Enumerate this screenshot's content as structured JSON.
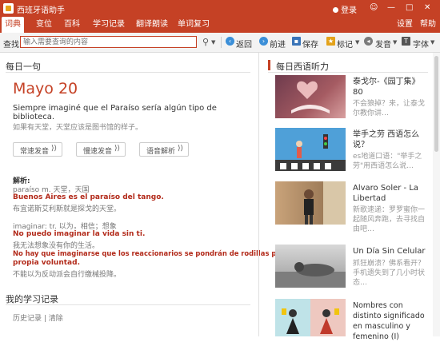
{
  "app": {
    "title": "西班牙语助手",
    "login_label": "登录",
    "window_controls": [
      "☺",
      "—",
      "□",
      "✕"
    ]
  },
  "menu": {
    "tabs": [
      "词典",
      "变位",
      "百科",
      "学习记录",
      "翻译朗读",
      "单词复习"
    ],
    "active_tab": "词典",
    "right_links": [
      "设置",
      "帮助"
    ]
  },
  "toolbar": {
    "search_label": "查找",
    "search_placeholder": "输入需要查询的内容",
    "buttons": [
      "返回",
      "前进",
      "保存",
      "标记",
      "发音",
      "字体"
    ]
  },
  "daily": {
    "section_title": "每日一句",
    "date": "Mayo 20",
    "sentence_es": "Siempre imaginé que el Paraíso sería algún tipo de biblioteca.",
    "sentence_zh": "如果有天堂，天堂应该是图书馆的样子。",
    "play_buttons": [
      "常速发音",
      "慢速发音",
      "语音解析"
    ],
    "analysis_title": "解析:",
    "analysis_lines": [
      {
        "text": "paraíso m. 天堂，天国",
        "style": "gray"
      },
      {
        "text": "Buenos Aires es el paraíso del tango.",
        "style": "red"
      },
      {
        "text": "布宜诺斯艾利斯就是探戈的天堂。",
        "style": "gray"
      },
      {
        "text": "imaginar: tr. 以为，相信；想象",
        "style": "gray"
      },
      {
        "text": "No puedo imaginar la vida sin ti.",
        "style": "red"
      },
      {
        "text": "我无法想象没有你的生活。",
        "style": "gray"
      },
      {
        "text": "No hay que imaginarse que los reaccionarios se pondrán de rodillas por",
        "style": "red"
      },
      {
        "text": "propia voluntad.",
        "style": "red"
      },
      {
        "text": "不能以为反动派会自行缴械投降。",
        "style": "gray"
      }
    ]
  },
  "history": {
    "section_title": "我的学习记录",
    "links": "历史记录 | 清除"
  },
  "listening": {
    "section_title": "每日西语听力",
    "items": [
      {
        "title": "泰戈尔-《园丁集》80",
        "subtitle": "不会狼掉？来，让泰戈尔教你讲…"
      },
      {
        "title": "举手之劳 西语怎么说？",
        "subtitle": "es地道口语：\"举手之劳\"用西语怎么说…"
      },
      {
        "title": "Alvaro Soler - La Libertad",
        "subtitle": "新歌速递：罗罗蜜你一起随风奔跑，去寻找自由吧…"
      },
      {
        "title": "Un Día Sin Celular",
        "subtitle": "抓狂崩溃？佛系看开？手机遗失到了几小时状态…"
      },
      {
        "title": "Nombres con distinto significado en masculino y femenino (I)",
        "subtitle": ""
      }
    ]
  },
  "colors": {
    "brand": "#c54125",
    "example_red": "#b22a1a"
  }
}
